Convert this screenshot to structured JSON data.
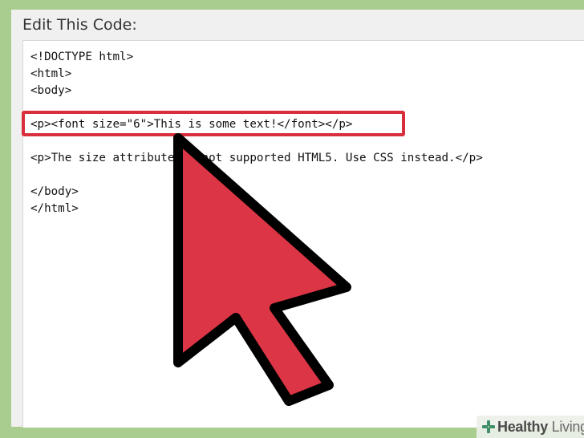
{
  "editor": {
    "title": "Edit This Code:",
    "code_lines": [
      "<!DOCTYPE html>",
      "<html>",
      "<body>",
      "",
      "<p><font size=\"6\">This is some text!</font></p>",
      "",
      "<p>The size attribute is not supported HTML5. Use CSS instead.</p>",
      "",
      "</body>",
      "</html>"
    ]
  },
  "watermark": {
    "word1": "Healthy",
    "word2": " Living"
  },
  "colors": {
    "background": "#a9cc8f",
    "highlight": "#d92e3c",
    "cursor_fill": "#dc3545",
    "cursor_stroke": "#000000"
  },
  "icons": {
    "cursor": "arrow-cursor-icon",
    "watermark": "plus-cross-icon"
  }
}
